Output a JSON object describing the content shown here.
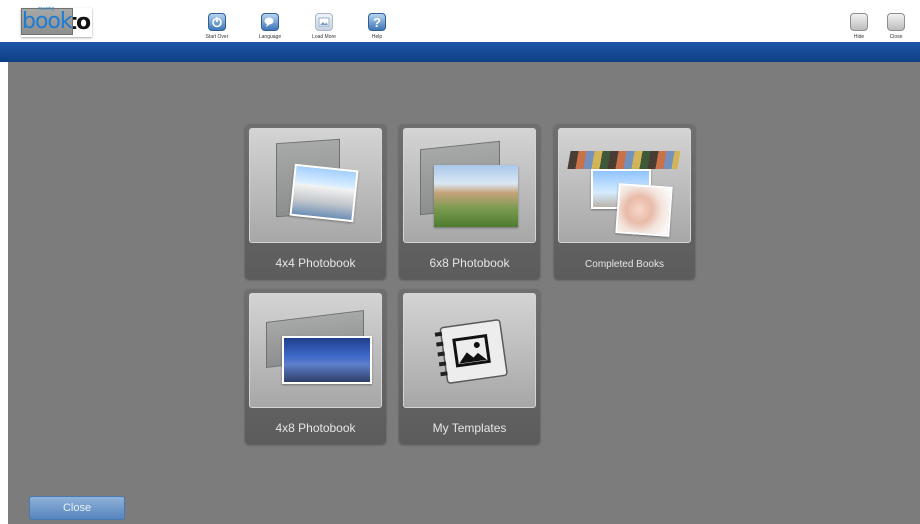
{
  "app": {
    "logo_text_prefix": "photo",
    "logo_text_suffix": "book",
    "logo_superscript": "mazing"
  },
  "toolbar": {
    "start_over": "Start Over",
    "language": "Language",
    "load_more": "Load More",
    "help": "Help",
    "hide": "Hide",
    "close": "Close"
  },
  "tiles": [
    {
      "label": "4x4 Photobook"
    },
    {
      "label": "6x8 Photobook"
    },
    {
      "label": "Completed Books"
    },
    {
      "label": "4x8 Photobook"
    },
    {
      "label": "My Templates"
    }
  ],
  "footer": {
    "close_label": "Close"
  },
  "colors": {
    "accent_blue": "#1f7bd3",
    "header_bar": "#124b96",
    "background": "#7c7c7c"
  },
  "icons": {
    "start_over": "power-icon",
    "language": "chat-icon",
    "load_more": "image-stack-icon",
    "help": "question-icon"
  }
}
